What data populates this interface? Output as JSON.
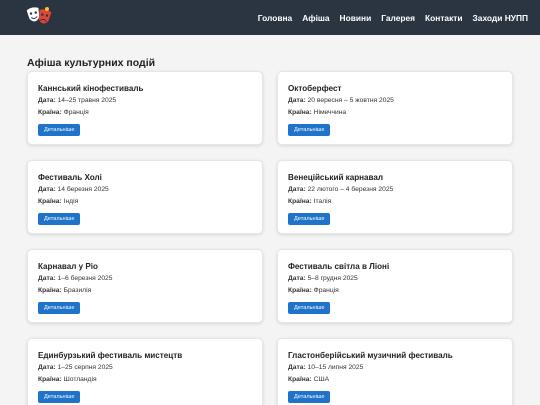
{
  "nav": {
    "items": [
      "Головна",
      "Афіша",
      "Новини",
      "Галерея",
      "Контакти",
      "Заходи НУПП"
    ]
  },
  "icons": {
    "logo": "theater-masks-icon"
  },
  "colors": {
    "header_bg": "#2b3542",
    "button_bg": "#1f73c8",
    "page_bg": "#f4f4f4"
  },
  "page": {
    "title": "Афіша культурних подій"
  },
  "labels": {
    "date": "Дата:",
    "country": "Країна:",
    "details_button": "Детальніше"
  },
  "events": [
    {
      "title": "Каннський кінофестиваль",
      "date": "14–25 травня 2025",
      "country": "Франція"
    },
    {
      "title": "Октоберфест",
      "date": "20 вересня – 5 жовтня 2025",
      "country": "Німеччина"
    },
    {
      "title": "Фестиваль Холі",
      "date": "14 березня 2025",
      "country": "Індія"
    },
    {
      "title": "Венеційський карнавал",
      "date": "22 лютого – 4 березня 2025",
      "country": "Італія"
    },
    {
      "title": "Карнавал у Ріо",
      "date": "1–6 березня 2025",
      "country": "Бразилія"
    },
    {
      "title": "Фестиваль світла в Ліоні",
      "date": "5–8 грудня 2025",
      "country": "Франція"
    },
    {
      "title": "Единбурзький фестиваль мистецтв",
      "date": "1–25 серпня 2025",
      "country": "Шотландія"
    },
    {
      "title": "Гластонберійський музичний фестиваль",
      "date": "10–15 липня 2025",
      "country": "США"
    }
  ]
}
